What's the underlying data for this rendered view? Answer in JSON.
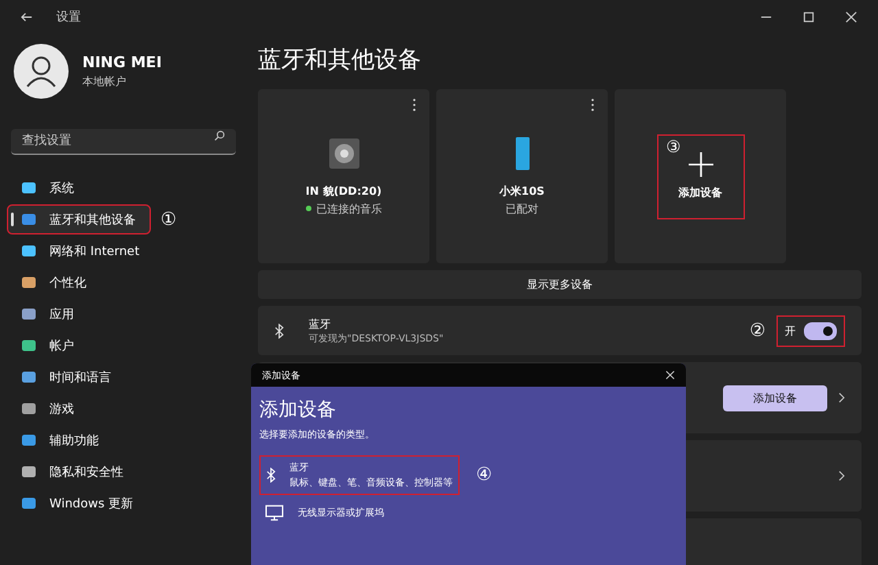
{
  "window": {
    "title": "设置"
  },
  "user": {
    "name": "NING MEI",
    "subtitle": "本地帐户"
  },
  "search": {
    "placeholder": "查找设置"
  },
  "nav": [
    {
      "label": "系统",
      "selected": false
    },
    {
      "label": "蓝牙和其他设备",
      "selected": true,
      "annotation": "①"
    },
    {
      "label": "网络和 Internet",
      "selected": false
    },
    {
      "label": "个性化",
      "selected": false
    },
    {
      "label": "应用",
      "selected": false
    },
    {
      "label": "帐户",
      "selected": false
    },
    {
      "label": "时间和语言",
      "selected": false
    },
    {
      "label": "游戏",
      "selected": false
    },
    {
      "label": "辅助功能",
      "selected": false
    },
    {
      "label": "隐私和安全性",
      "selected": false
    },
    {
      "label": "Windows 更新",
      "selected": false
    }
  ],
  "page_title": "蓝牙和其他设备",
  "devices": [
    {
      "kind": "speaker",
      "name": "IN 貌(DD:20)",
      "status": "已连接的音乐",
      "connected": true
    },
    {
      "kind": "phone",
      "name": "小米10S",
      "status": "已配对",
      "connected": false
    }
  ],
  "add_tile": {
    "label": "添加设备",
    "annotation": "③"
  },
  "show_more": "显示更多设备",
  "bluetooth": {
    "title": "蓝牙",
    "subtitle": "可发现为\"DESKTOP-VL3JSDS\"",
    "toggle_label": "开",
    "on": true,
    "annotation": "②"
  },
  "rows": [
    {
      "kind": "button",
      "button": "添加设备"
    },
    {
      "kind": "chevron"
    }
  ],
  "dialog": {
    "title": "添加设备",
    "heading": "添加设备",
    "prompt": "选择要添加的设备的类型。",
    "options": [
      {
        "kind": "bluetooth",
        "title": "蓝牙",
        "description": "鼠标、键盘、笔、音频设备、控制器等",
        "annotation": "④"
      },
      {
        "kind": "monitor",
        "title": "无线显示器或扩展坞"
      }
    ]
  }
}
